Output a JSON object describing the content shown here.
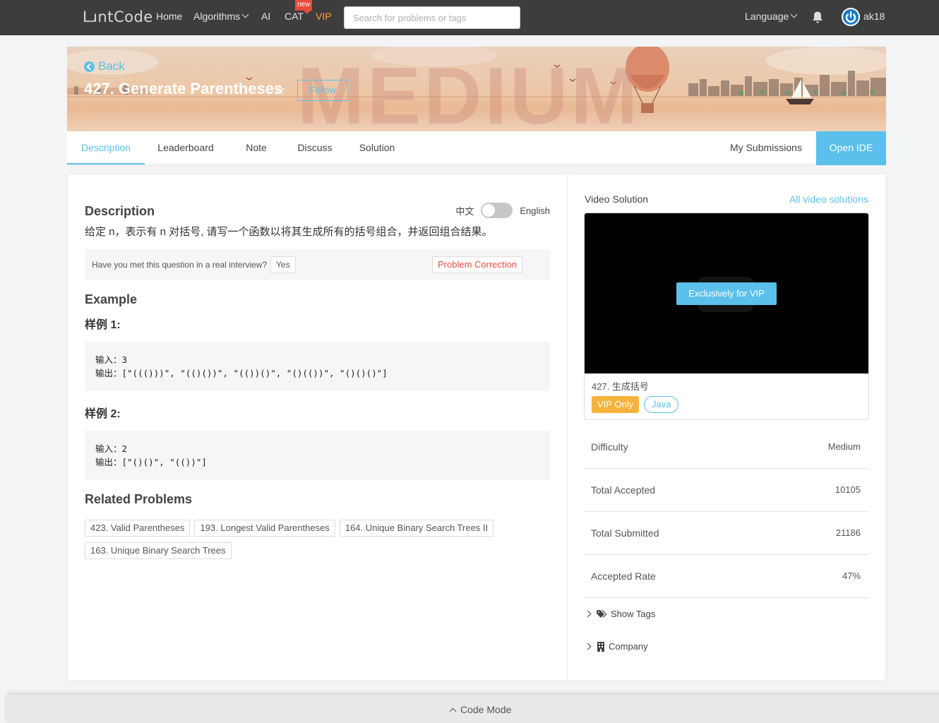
{
  "nav": {
    "logo": "LɹntCode",
    "home": "Home",
    "algorithms": "Algorithms",
    "ai": "AI",
    "cat": "CAT",
    "new_badge": "new",
    "vip": "VIP",
    "search_placeholder": "Search for problems or tags",
    "language": "Language",
    "username": "ak18"
  },
  "banner": {
    "back": "Back",
    "title": "427. Generate Parentheses",
    "follow": "Follow",
    "difficulty_watermark": "MEDIUM"
  },
  "tabs": {
    "description": "Description",
    "leaderboard": "Leaderboard",
    "note": "Note",
    "discuss": "Discuss",
    "solution": "Solution",
    "my_submissions": "My Submissions",
    "open_ide": "Open IDE"
  },
  "problem": {
    "heading": "Description",
    "lang_zh": "中文",
    "lang_en": "English",
    "text": "给定 n，表示有 n 对括号, 请写一个函数以将其生成所有的括号组合，并返回组合结果。",
    "interview_question": "Have you met this question in a real interview?",
    "yes": "Yes",
    "correction": "Problem Correction",
    "example_heading": "Example",
    "examples": [
      {
        "label": "样例 1:",
        "input": "输入：3",
        "output": "输出：[\"((()))\", \"(()())\", \"(())()\", \"()(())\", \"()()()\"]"
      },
      {
        "label": "样例 2:",
        "input": "输入：2",
        "output": "输出：[\"()()\", \"(())\"]"
      }
    ],
    "related_heading": "Related Problems",
    "related": [
      "423. Valid Parentheses",
      "193. Longest Valid Parentheses",
      "164. Unique Binary Search Trees II",
      "163. Unique Binary Search Trees"
    ]
  },
  "side": {
    "video_solution": "Video Solution",
    "all_videos": "All video solutions",
    "vip_exclusive": "Exclusively for VIP",
    "video_title": "427. 生成括号",
    "vip_only": "VIP Only",
    "java": "Java",
    "stats": [
      {
        "label": "Difficulty",
        "value": "Medium"
      },
      {
        "label": "Total Accepted",
        "value": "10105"
      },
      {
        "label": "Total Submitted",
        "value": "21186"
      },
      {
        "label": "Accepted Rate",
        "value": "47%"
      }
    ],
    "show_tags": "Show Tags",
    "company": "Company"
  },
  "footer": {
    "code_mode": "Code Mode"
  },
  "colors": {
    "accent": "#5bc0eb",
    "nav_bg": "#3d3d3d",
    "vip": "#f5a623",
    "danger": "#e74c3c"
  }
}
